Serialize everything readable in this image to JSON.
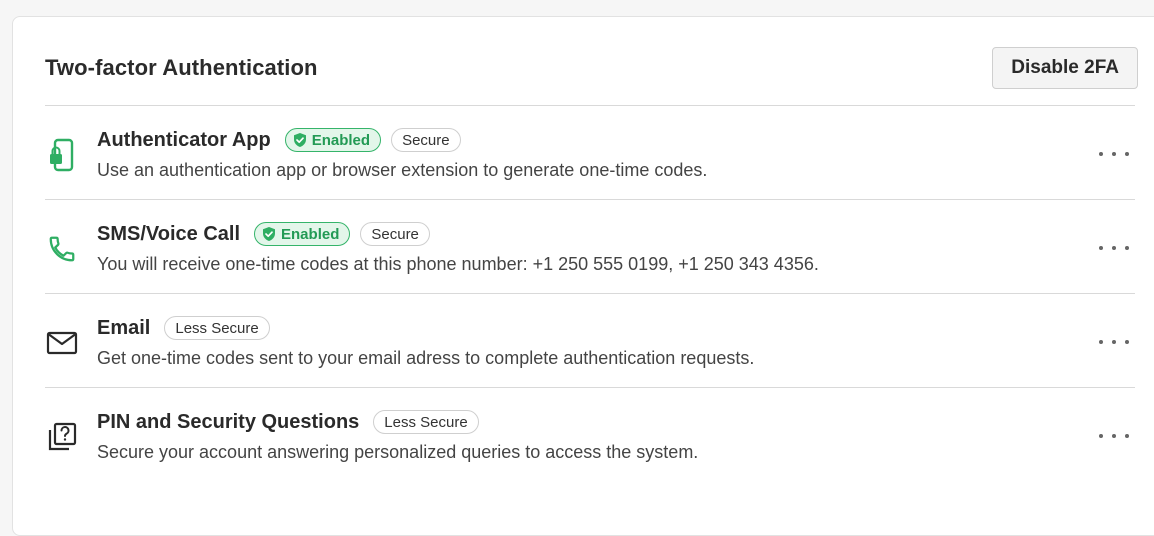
{
  "header": {
    "title": "Two-factor Authentication",
    "disable_button_label": "Disable 2FA"
  },
  "colors": {
    "accent_green": "#35b46a",
    "enabled_bg": "#e3f6ea",
    "divider": "#d9d9d9"
  },
  "methods": [
    {
      "icon": "phone-lock-icon",
      "title": "Authenticator App",
      "badges": [
        "Enabled",
        "Secure"
      ],
      "description": "Use an authentication app or browser extension to generate one-time codes."
    },
    {
      "icon": "phone-call-icon",
      "title": "SMS/Voice Call",
      "badges": [
        "Enabled",
        "Secure"
      ],
      "description": "You will receive one-time codes at this phone number: +1 250 555 0199, +1 250 343 4356."
    },
    {
      "icon": "envelope-icon",
      "title": "Email",
      "badges": [
        "Less Secure"
      ],
      "description": "Get one-time codes sent to your email adress to complete authentication requests."
    },
    {
      "icon": "question-cards-icon",
      "title": "PIN and Security Questions",
      "badges": [
        "Less Secure"
      ],
      "description": "Secure your account answering personalized queries to access the system."
    }
  ]
}
